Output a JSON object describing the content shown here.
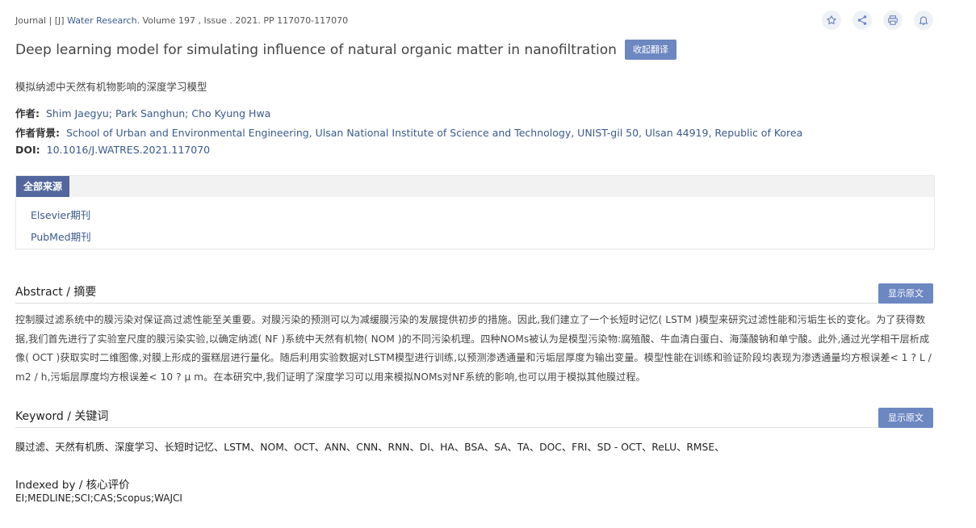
{
  "header": {
    "source_prefix": "Journal | [J] ",
    "source_journal": "Water Research",
    "source_rest": ". Volume 197 , Issue . 2021. PP 117070-117070",
    "title": "Deep learning model for simulating influence of natural organic matter in nanofiltration",
    "translate_label": "收起翻译",
    "cn_title": "模拟纳滤中天然有机物影响的深度学习模型",
    "icons": [
      "star-icon",
      "share-icon",
      "print-icon",
      "bell-icon"
    ]
  },
  "meta": {
    "authors_label": "作者:",
    "authors": "Shim Jaegyu; Park Sanghun; Cho Kyung Hwa",
    "affiliation_label": "作者背景:",
    "affiliation": "School of Urban and Environmental Engineering, Ulsan National Institute of Science and Technology, UNIST-gil 50, Ulsan 44919, Republic of Korea",
    "doi_label": "DOI:",
    "doi": "10.1016/J.WATRES.2021.117070"
  },
  "sources": {
    "tab_label": "全部来源",
    "items": [
      "Elsevier期刊",
      "PubMed期刊"
    ]
  },
  "abstract": {
    "title": "Abstract / 摘要",
    "show_label": "显示原文",
    "text": "控制膜过滤系统中的膜污染对保证高过滤性能至关重要。对膜污染的预测可以为减缓膜污染的发展提供初步的措施。因此,我们建立了一个长短时记忆( LSTM )模型来研究过滤性能和污垢生长的变化。为了获得数据,我们首先进行了实验室尺度的膜污染实验,以确定纳滤( NF )系统中天然有机物( NOM )的不同污染机理。四种NOMs被认为是模型污染物:腐殖酸、牛血清白蛋白、海藻酸钠和单宁酸。此外,通过光学相干层析成像( OCT )获取实时二维图像,对膜上形成的蛋糕层进行量化。随后利用实验数据对LSTM模型进行训练,以预测渗透通量和污垢层厚度为输出变量。模型性能在训练和验证阶段均表现为渗透通量均方根误差< 1 ? L / m2 / h,污垢层厚度均方根误差< 10 ? μ m。在本研究中,我们证明了深度学习可以用来模拟NOMs对NF系统的影响,也可以用于模拟其他膜过程。"
  },
  "keywords": {
    "title": "Keyword / 关键词",
    "show_label": "显示原文",
    "text": "膜过滤、天然有机质、深度学习、长短时记忆、LSTM、NOM、OCT、ANN、CNN、RNN、DI、HA、BSA、SA、TA、DOC、FRI、SD - OCT、ReLU、RMSE、"
  },
  "indexed": {
    "title": "Indexed by / 核心评价",
    "value": "EI;MEDLINE;SCI;CAS;Scopus;WAJCI"
  },
  "colors": {
    "accent": "#3a5a8c",
    "button": "#6d87c1",
    "tab": "#53679e"
  }
}
